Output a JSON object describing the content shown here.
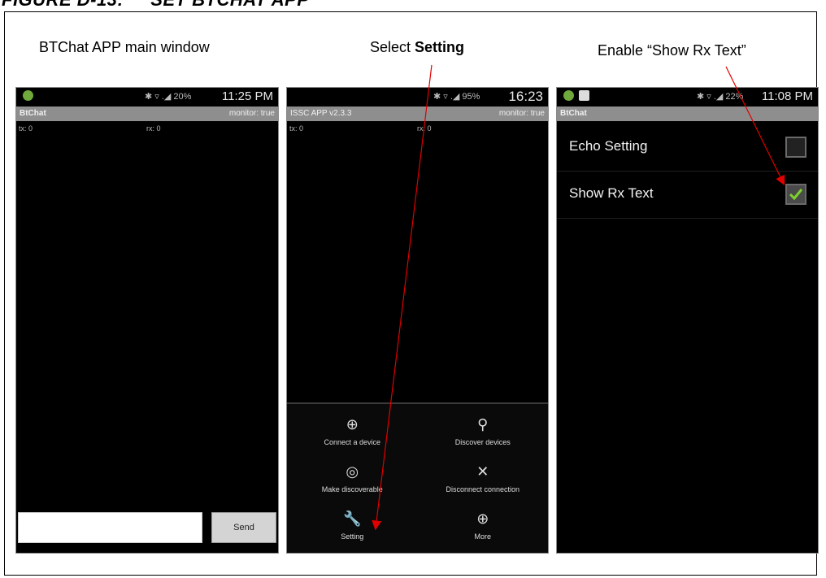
{
  "figure_title": "FIGURE D-13:     SET BTCHAT APP",
  "captions": {
    "main": "BTChat APP main window",
    "select_prefix": "Select ",
    "select_bold": "Setting",
    "enable": "Enable “Show Rx Text”"
  },
  "phone1": {
    "status_icons": "✱ ▿ .◢ 20%",
    "time": "11:25 PM",
    "app_title": "BtChat",
    "monitor": "monitor: true",
    "tx": "tx: 0",
    "rx": "rx: 0",
    "send_label": "Send",
    "input_value": ""
  },
  "phone2": {
    "status_icons": "✱ ▿ .◢ 95%",
    "time": "16:23",
    "app_title": "ISSC APP v2.3.3",
    "monitor": "monitor: true",
    "tx": "tx: 0",
    "rx": "rx: 0",
    "menu": [
      {
        "label": "Connect a device",
        "icon": "crosshair-icon"
      },
      {
        "label": "Discover devices",
        "icon": "search-icon"
      },
      {
        "label": "Make discoverable",
        "icon": "target-icon"
      },
      {
        "label": "Disconnect connection",
        "icon": "close-icon"
      },
      {
        "label": "Setting",
        "icon": "wrench-icon"
      },
      {
        "label": "More",
        "icon": "chevron-down-circle-icon"
      }
    ]
  },
  "phone3": {
    "status_icons": "✱ ▿ .◢ 22%",
    "time": "11:08 PM",
    "app_title": "BtChat",
    "settings": [
      {
        "label": "Echo Setting",
        "checked": false
      },
      {
        "label": "Show Rx Text",
        "checked": true
      }
    ]
  },
  "colors": {
    "arrow": "#e00000",
    "checkmark": "#7cd12c"
  }
}
